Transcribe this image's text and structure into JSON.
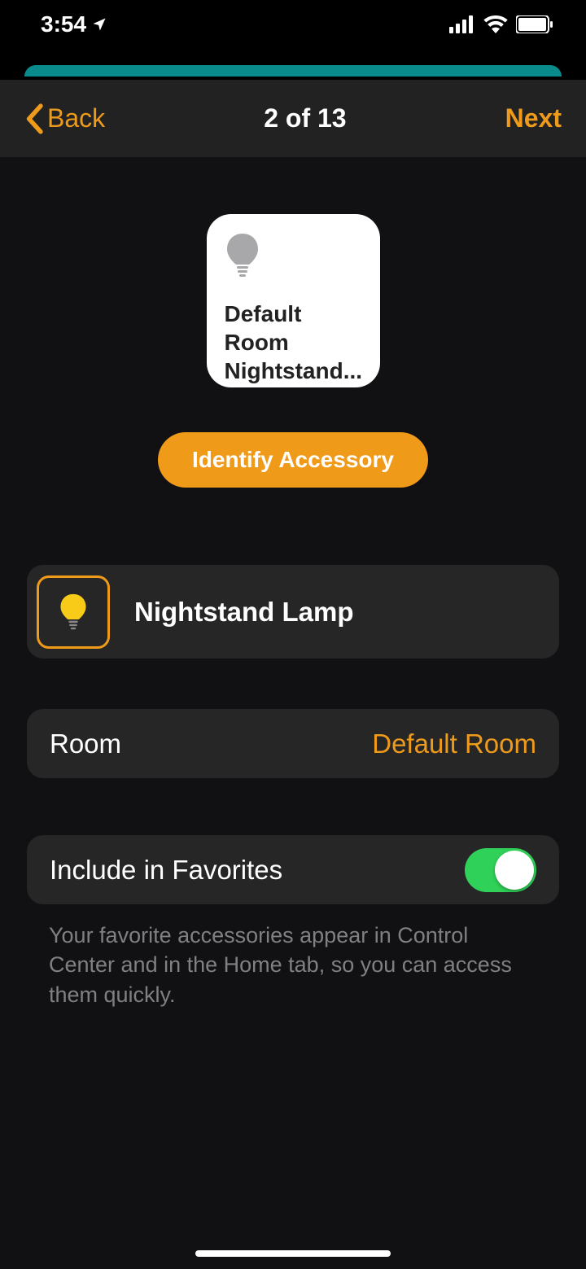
{
  "status": {
    "time": "3:54"
  },
  "nav": {
    "back": "Back",
    "title": "2 of 13",
    "next": "Next"
  },
  "tile": {
    "line1": "Default Room",
    "line2": "Nightstand..."
  },
  "identify": "Identify Accessory",
  "name_field": {
    "value": "Nightstand Lamp"
  },
  "room": {
    "label": "Room",
    "value": "Default Room"
  },
  "favorites": {
    "label": "Include in Favorites",
    "footer": "Your favorite accessories appear in Control Center and in the Home tab, so you can access them quickly."
  }
}
